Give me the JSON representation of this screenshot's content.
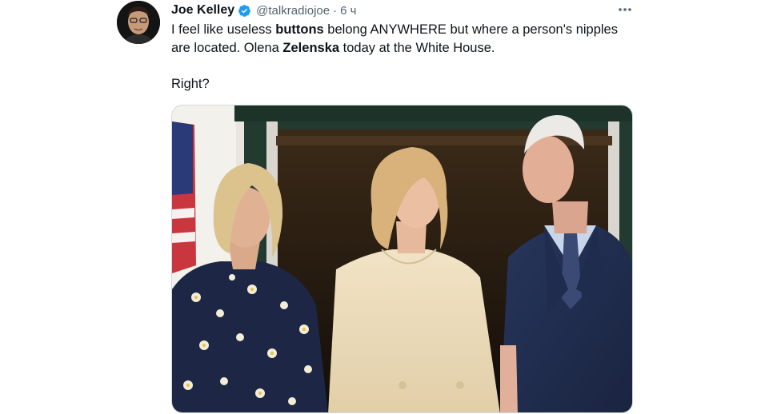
{
  "tweet": {
    "author": {
      "name": "Joe Kelley",
      "handle": "@talkradiojoe",
      "separator": "·",
      "time": "6 ч"
    },
    "text": {
      "line1_pre": "I feel like useless ",
      "line1_bold": "buttons",
      "line1_post": " belong ANYWHERE but where a person's nipples",
      "line2_pre": "are located. Olena ",
      "line2_bold": "Zelenska",
      "line2_post": " today at the White House.",
      "line3": "Right?"
    },
    "icons": {
      "verified": "verified-badge-icon",
      "more": "more-options-icon"
    },
    "colors": {
      "verified_blue": "#1d9bf0",
      "secondary_text": "#536471",
      "primary_text": "#0f1419"
    },
    "media": {
      "description_icon": "photo"
    }
  }
}
